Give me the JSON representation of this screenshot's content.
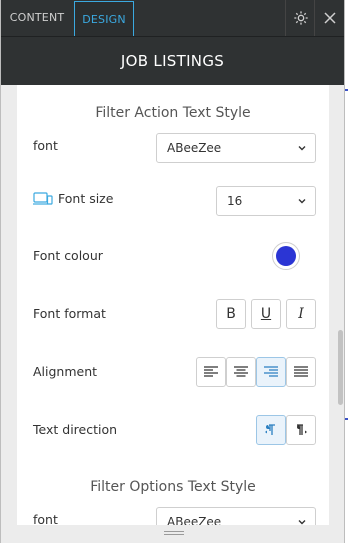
{
  "tabs": {
    "content": "CONTENT",
    "design": "DESIGN"
  },
  "header": {
    "title": "JOB LISTINGS"
  },
  "sections": {
    "filter_action_title": "Filter Action Text Style",
    "filter_options_title": "Filter Options Text Style"
  },
  "fields": {
    "font_label": "font",
    "font_value": "ABeeZee",
    "font_size_label": "Font size",
    "font_size_value": "16",
    "font_colour_label": "Font colour",
    "font_colour_value": "#2b35d4",
    "font_format_label": "Font format",
    "format_bold": "B",
    "format_underline": "U",
    "format_italic": "I",
    "alignment_label": "Alignment",
    "text_direction_label": "Text direction",
    "font2_label": "font",
    "font2_value": "ABeeZee"
  },
  "state": {
    "active_tab": "design",
    "alignment_selected": "right",
    "text_direction_selected": "ltr"
  },
  "colors": {
    "accent": "#3ba9e0",
    "header_bg": "#2f3233"
  }
}
